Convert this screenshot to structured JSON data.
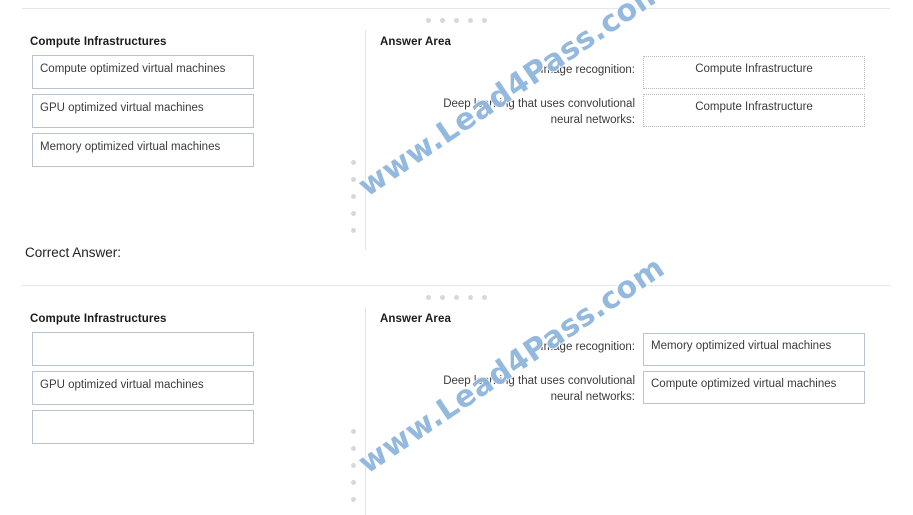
{
  "watermark": {
    "text": "www.Lead4Pass.com",
    "color": "#8fb6de"
  },
  "caption": {
    "correct_answer": "Correct Answer:"
  },
  "theme": {
    "box_border": "#b9c3cd",
    "dotted_border": "#b9b9b9",
    "rule": "#e4e6e8",
    "dot": "#d6d8da"
  },
  "question": {
    "source_panel": {
      "title": "Compute Infrastructures",
      "items": [
        "Compute optimized virtual machines",
        "GPU optimized virtual machines",
        "Memory optimized virtual machines"
      ]
    },
    "answer_panel": {
      "title": "Answer Area",
      "rows": [
        {
          "label": "Image recognition:",
          "value": "Compute Infrastructure",
          "state": "placeholder"
        },
        {
          "label": "Deep learning that uses convolutional neural networks:",
          "value": "Compute Infrastructure",
          "state": "placeholder"
        }
      ]
    }
  },
  "answer": {
    "source_panel": {
      "title": "Compute Infrastructures",
      "items": [
        "",
        "GPU optimized virtual machines",
        ""
      ]
    },
    "answer_panel": {
      "title": "Answer Area",
      "rows": [
        {
          "label": "Image recognition:",
          "value": "Memory optimized virtual machines",
          "state": "filled"
        },
        {
          "label": "Deep learning that uses convolutional neural networks:",
          "value": "Compute optimized virtual machines",
          "state": "filled"
        }
      ]
    }
  }
}
